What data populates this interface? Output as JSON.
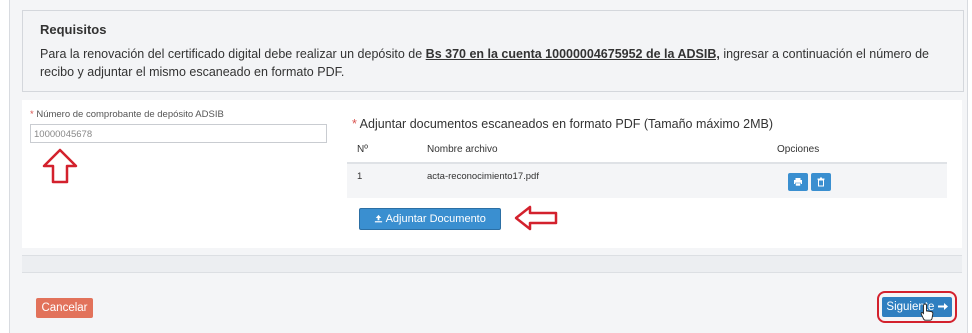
{
  "requisitos": {
    "title": "Requisitos",
    "text_before": "Para la renovación del certificado digital debe realizar un depósito de ",
    "text_bold": "Bs 370 en la cuenta 10000004675952 de la ADSIB,",
    "text_after": " ingresar a continuación el número de recibo y adjuntar el mismo escaneado en formato PDF."
  },
  "deposit": {
    "star": "*",
    "label": " Número de comprobante de depósito ADSIB",
    "value": "10000045678"
  },
  "upload": {
    "star": "*",
    "label": " Adjuntar documentos escaneados en formato PDF (Tamaño máximo 2MB)",
    "columns": [
      "Nº",
      "Nombre archivo",
      "Opciones"
    ],
    "rows": [
      {
        "n": "1",
        "name": "acta-reconocimiento17.pdf"
      }
    ],
    "button_label": "Adjuntar Documento"
  },
  "footer": {
    "cancel_label": "Cancelar",
    "next_label": "Siguiente"
  },
  "colors": {
    "primary": "#3a8fd0",
    "cancel": "#e2725b",
    "annotation_red": "#d3212d"
  },
  "icons": [
    "upload-icon",
    "print-icon",
    "trash-icon",
    "arrow-right-icon",
    "hand-cursor-icon"
  ]
}
